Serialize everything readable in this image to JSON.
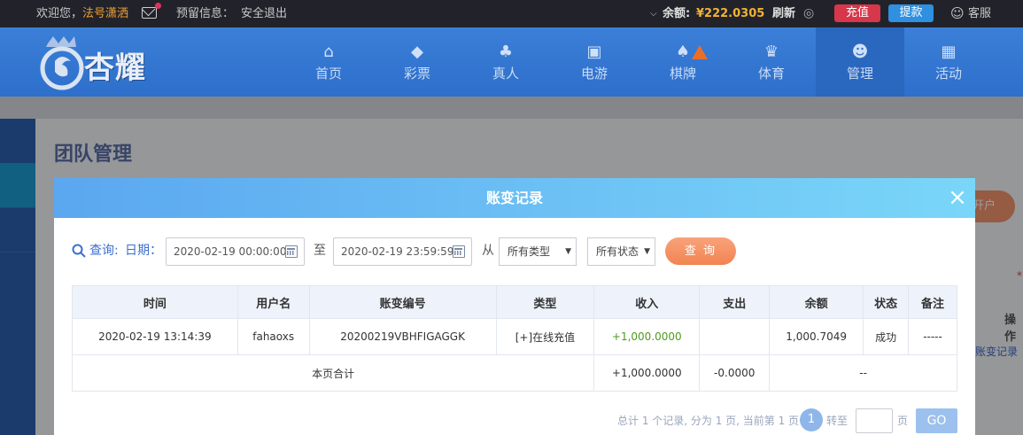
{
  "topbar": {
    "welcome": "欢迎您，",
    "username": "法号潇洒",
    "reserved_info": "预留信息：",
    "logout": "安全退出",
    "balance_label": "余额:",
    "balance_amount": "¥222.0305",
    "refresh": "刷新",
    "recharge": "充值",
    "withdraw": "提款",
    "service": "客服"
  },
  "logo": {
    "text": "杏耀"
  },
  "nav": [
    {
      "label": "首页",
      "icon": "home-icon"
    },
    {
      "label": "彩票",
      "icon": "lottery-icon"
    },
    {
      "label": "真人",
      "icon": "live-dealer-icon"
    },
    {
      "label": "电游",
      "icon": "slot-game-icon"
    },
    {
      "label": "棋牌",
      "icon": "card-game-icon"
    },
    {
      "label": "体育",
      "icon": "sports-trophy-icon"
    },
    {
      "label": "管理",
      "icon": "users-icon"
    },
    {
      "label": "活动",
      "icon": "gift-icon"
    }
  ],
  "page": {
    "title": "团队管理",
    "bg_button_partial": "开户",
    "bg_column_partial": "操作",
    "bg_link_partial": "账变记录"
  },
  "modal": {
    "title": "账变记录",
    "query_label": "查询:",
    "date_label": "日期：",
    "start_date": "2020-02-19 00:00:00",
    "to_label": "至",
    "end_date": "2020-02-19 23:59:59",
    "from_label": "从",
    "type_select": "所有类型",
    "status_select": "所有状态",
    "query_button": "查 询",
    "columns": [
      "时间",
      "用户名",
      "账变编号",
      "类型",
      "收入",
      "支出",
      "余额",
      "状态",
      "备注"
    ],
    "rows": [
      {
        "time": "2020-02-19 13:14:39",
        "user": "fahaoxs",
        "txn_id": "20200219VBHFIGAGGK",
        "type": "[+]在线充值",
        "income": "+1,000.0000",
        "expense": "",
        "balance": "1,000.7049",
        "status": "成功",
        "note": "-----"
      }
    ],
    "subtotal": {
      "label": "本页合计",
      "income": "+1,000.0000",
      "expense": "-0.0000",
      "rest": "--"
    },
    "pager": {
      "summary": "总计 1 个记录, 分为 1 页, 当前第 1 页",
      "current_page": "1",
      "goto_label": "转至",
      "page_unit": "页",
      "go_button": "GO"
    }
  }
}
